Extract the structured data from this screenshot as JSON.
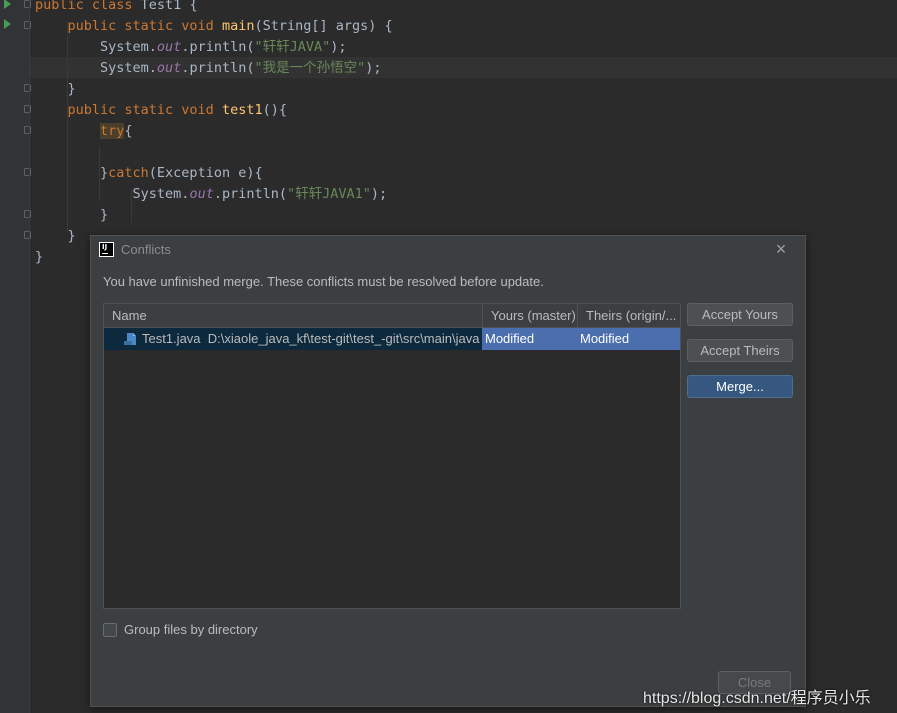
{
  "editor": {
    "lines": [
      [
        {
          "t": "public class ",
          "c": "kw"
        },
        {
          "t": "Test1 {",
          "c": ""
        }
      ],
      [
        {
          "t": "    public static void ",
          "c": "kw"
        },
        {
          "t": "main",
          "c": "fn"
        },
        {
          "t": "(String[] args) {",
          "c": ""
        }
      ],
      [
        {
          "t": "        System.",
          "c": ""
        },
        {
          "t": "out",
          "c": "st"
        },
        {
          "t": ".println(",
          "c": ""
        },
        {
          "t": "\"轩轩JAVA\"",
          "c": "str"
        },
        {
          "t": ");",
          "c": ""
        }
      ],
      [
        {
          "t": "        System.",
          "c": ""
        },
        {
          "t": "out",
          "c": "st"
        },
        {
          "t": ".println(",
          "c": ""
        },
        {
          "t": "\"我是一个孙悟空\"",
          "c": "str"
        },
        {
          "t": ");",
          "c": ""
        }
      ],
      [
        {
          "t": "    }",
          "c": ""
        }
      ],
      [
        {
          "t": "    public static void ",
          "c": "kw"
        },
        {
          "t": "test1",
          "c": "fn"
        },
        {
          "t": "(){",
          "c": ""
        }
      ],
      [
        {
          "t": "        ",
          "c": ""
        },
        {
          "t": "try",
          "c": "kw try-hl"
        },
        {
          "t": "{",
          "c": ""
        }
      ],
      [
        {
          "t": "",
          "c": ""
        }
      ],
      [
        {
          "t": "        }",
          "c": ""
        },
        {
          "t": "catch",
          "c": "kw"
        },
        {
          "t": "(Exception e){",
          "c": ""
        }
      ],
      [
        {
          "t": "            System.",
          "c": ""
        },
        {
          "t": "out",
          "c": "st"
        },
        {
          "t": ".println(",
          "c": ""
        },
        {
          "t": "\"轩轩JAVA1\"",
          "c": "str"
        },
        {
          "t": ");",
          "c": ""
        }
      ],
      [
        {
          "t": "        }",
          "c": ""
        }
      ],
      [
        {
          "t": "    }",
          "c": ""
        }
      ],
      [
        {
          "t": "}",
          "c": ""
        }
      ]
    ]
  },
  "dialog": {
    "title": "Conflicts",
    "close_icon": "×",
    "message": "You have unfinished merge. These conflicts must be resolved before update.",
    "table": {
      "columns": [
        "Name",
        "Yours (master)",
        "Theirs (origin/..."
      ],
      "rows": [
        {
          "file": "Test1.java",
          "path": "D:\\xiaole_java_kf\\test-git\\test_-git\\src\\main\\java",
          "yours": "Modified",
          "theirs": "Modified"
        }
      ]
    },
    "buttons": {
      "accept_yours": "Accept Yours",
      "accept_theirs": "Accept Theirs",
      "merge": "Merge...",
      "close": "Close"
    },
    "group_by_directory_label": "Group files by directory"
  },
  "watermark": "https://blog.csdn.net/程序员小乐",
  "colors": {
    "accent": "#365880",
    "selection": "#4b6eaf",
    "background": "#2b2b2b",
    "dialog": "#3c3f41"
  }
}
